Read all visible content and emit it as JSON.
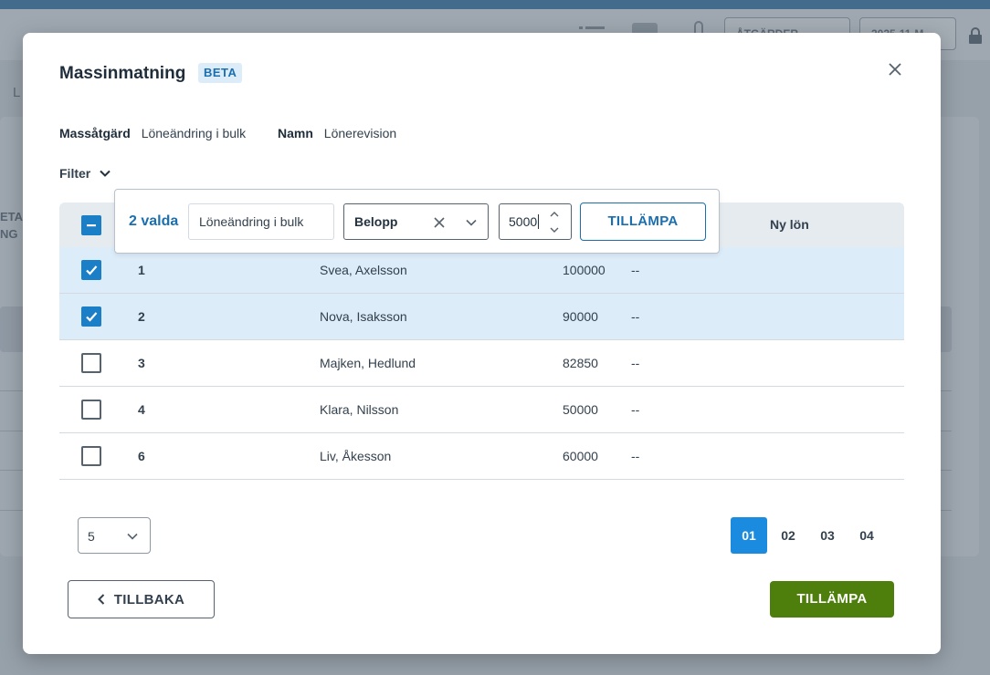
{
  "background": {
    "header_button_actions": "ÅTGÄRDER",
    "header_button_date": "2025-11-M",
    "left_label": "L",
    "column_stub": [
      "ETA",
      "NG"
    ]
  },
  "modal": {
    "title": "Massinmatning",
    "badge": "BETA",
    "mass_action_label": "Massåtgärd",
    "mass_action_value": "Löneändring i bulk",
    "name_label": "Namn",
    "name_value": "Lönerevision",
    "filter_label": "Filter"
  },
  "bulk": {
    "selected_count": "2 valda",
    "action_field": "Löneändring i bulk",
    "type_select": "Belopp",
    "amount_value": "5000",
    "apply_label": "TILLÄMPA"
  },
  "table": {
    "new_salary_header": "Ny lön",
    "rows": [
      {
        "id": "1",
        "name": "Svea, Axelsson",
        "salary": "100000",
        "new_salary": "--",
        "checked": true
      },
      {
        "id": "2",
        "name": "Nova, Isaksson",
        "salary": "90000",
        "new_salary": "--",
        "checked": true
      },
      {
        "id": "3",
        "name": "Majken, Hedlund",
        "salary": "82850",
        "new_salary": "--",
        "checked": false
      },
      {
        "id": "4",
        "name": "Klara, Nilsson",
        "salary": "50000",
        "new_salary": "--",
        "checked": false
      },
      {
        "id": "6",
        "name": "Liv, Åkesson",
        "salary": "60000",
        "new_salary": "--",
        "checked": false
      }
    ]
  },
  "pagination": {
    "page_size": "5",
    "pages": [
      "01",
      "02",
      "03",
      "04"
    ],
    "active_page": "01"
  },
  "footer": {
    "back_label": "TILLBAKA",
    "apply_label": "TILLÄMPA"
  },
  "colors": {
    "primary": "#1b6fae",
    "active_page": "#1b8be0",
    "apply_green": "#4e7f0d",
    "selected_row": "#dcecf8"
  }
}
